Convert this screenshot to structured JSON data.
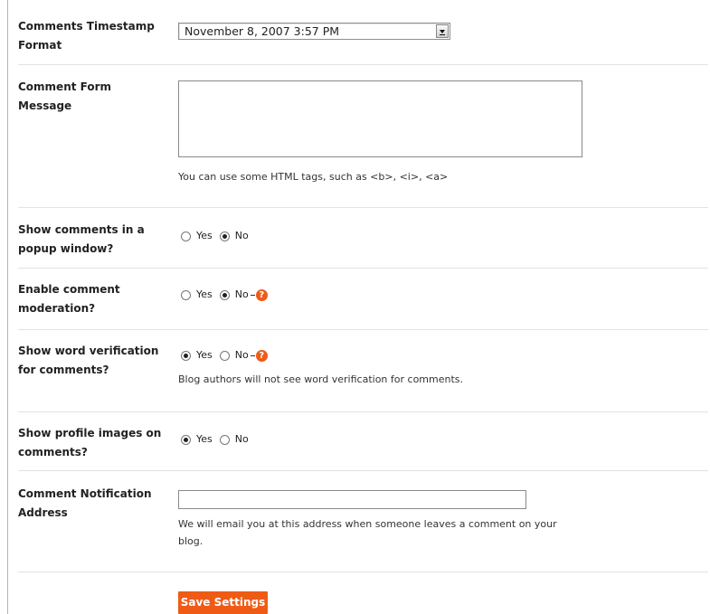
{
  "timestamp_format": {
    "label_line1": "Comments Timestamp",
    "label_line2": "Format",
    "selected": "November 8, 2007 3:57 PM"
  },
  "comment_form_message": {
    "label": "Comment Form Message",
    "value": "",
    "hint": "You can use some HTML tags, such as <b>, <i>, <a>"
  },
  "popup_window": {
    "label_line1": "Show comments in a",
    "label_line2": "popup window?",
    "yes": "Yes",
    "no": "No",
    "selected": "No"
  },
  "moderation": {
    "label_line1": "Enable comment",
    "label_line2": "moderation?",
    "yes": "Yes",
    "no": "No",
    "selected": "No",
    "help": "?"
  },
  "word_verification": {
    "label_line1": "Show word verification",
    "label_line2": "for comments?",
    "yes": "Yes",
    "no": "No",
    "selected": "Yes",
    "help": "?",
    "hint": "Blog authors will not see word verification for comments."
  },
  "profile_images": {
    "label_line1": "Show profile images on",
    "label_line2": "comments?",
    "yes": "Yes",
    "no": "No",
    "selected": "Yes"
  },
  "notification": {
    "label_line1": "Comment Notification",
    "label_line2": "Address",
    "value": "",
    "hint_line1": "We will email you at this address when someone leaves a comment on your",
    "hint_line2": "blog."
  },
  "save_button": "Save Settings",
  "colors": {
    "accent": "#ef5b16",
    "help_icon": "#ef5a17",
    "separator": "#e3e3e3"
  }
}
